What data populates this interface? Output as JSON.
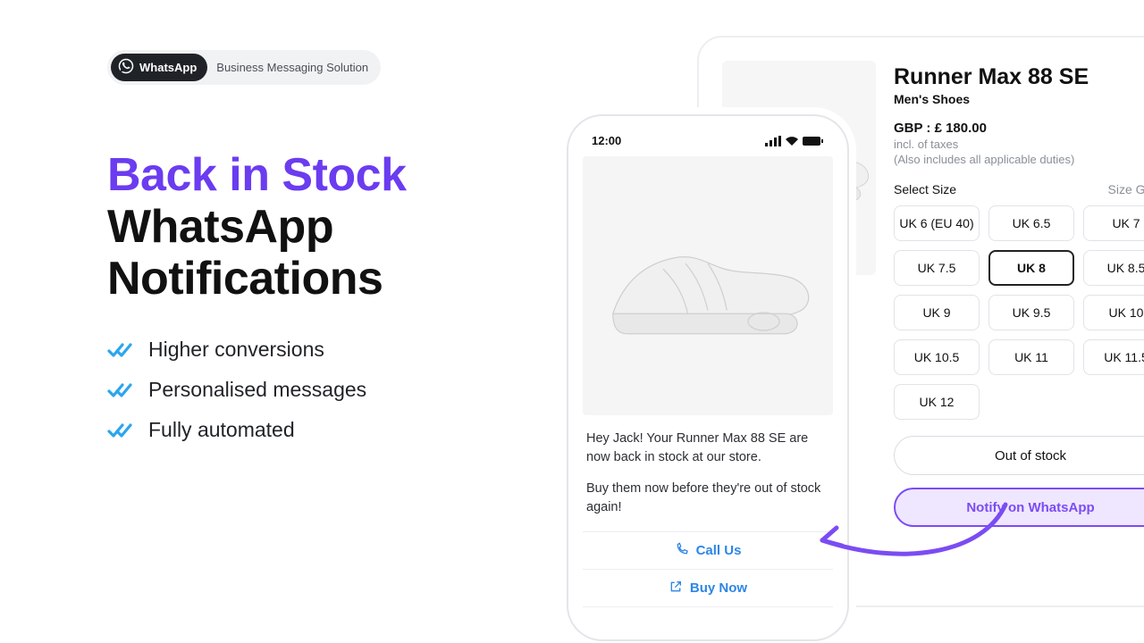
{
  "badge": {
    "brand": "WhatsApp",
    "suffix": "Business Messaging Solution"
  },
  "headline": {
    "line1": "Back in Stock",
    "line2": "WhatsApp",
    "line3": "Notifications"
  },
  "benefits": [
    "Higher conversions",
    "Personalised messages",
    "Fully automated"
  ],
  "product": {
    "title": "Runner Max 88 SE",
    "subtitle": "Men's Shoes",
    "price_line": "GBP : £ 180.00",
    "tax_line": "incl. of taxes",
    "duties_line": "(Also includes all applicable duties)",
    "size_label": "Select Size",
    "size_guide": "Size Guide",
    "sizes": [
      "UK 6 (EU 40)",
      "UK 6.5",
      "UK 7",
      "UK 7.5",
      "UK 8",
      "UK 8.5",
      "UK 9",
      "UK 9.5",
      "UK 10",
      "UK 10.5",
      "UK 11",
      "UK 11.5",
      "UK 12"
    ],
    "selected_size_index": 4,
    "out_of_stock_label": "Out of stock",
    "notify_label": "Notify on WhatsApp"
  },
  "phone": {
    "time": "12:00",
    "message_line1": "Hey Jack! Your Runner Max 88 SE are now back in stock at our store.",
    "message_line2": "Buy them now before they're out of stock again!",
    "call_label": "Call Us",
    "buy_label": "Buy Now"
  }
}
